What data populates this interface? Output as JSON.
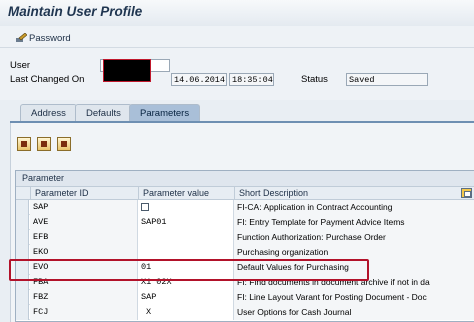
{
  "window": {
    "title": "Maintain User Profile"
  },
  "toolbar": {
    "password_label": "Password"
  },
  "header": {
    "user_label": "User",
    "user_value": "",
    "last_changed_label": "Last Changed On",
    "date_value": "14.06.2014",
    "time_value": "18:35:04",
    "status_label": "Status",
    "status_value": "Saved"
  },
  "tabs": [
    {
      "label": "Address",
      "active": false
    },
    {
      "label": "Defaults",
      "active": false
    },
    {
      "label": "Parameters",
      "active": true
    }
  ],
  "grid": {
    "caption": "Parameter",
    "columns": [
      "Parameter ID",
      "Parameter value",
      "Short Description"
    ],
    "rows": [
      {
        "id": "SAP",
        "value": "",
        "desc": "FI-CA: Application in Contract Accounting"
      },
      {
        "id": "AVE",
        "value": "SAP01",
        "desc": "FI: Entry Template for Payment Advice Items"
      },
      {
        "id": "EFB",
        "value": "",
        "desc": "Function Authorization: Purchase Order"
      },
      {
        "id": "EKO",
        "value": "",
        "desc": "Purchasing organization"
      },
      {
        "id": "EVO",
        "value": "01",
        "desc": "Default Values for Purchasing"
      },
      {
        "id": "FBA",
        "value": "X1 02X",
        "desc": "FI: Find documents in document archive if not in da"
      },
      {
        "id": "FBZ",
        "value": "SAP",
        "desc": "FI: Line Layout Varant for Posting Document - Doc"
      },
      {
        "id": "FCJ",
        "value": "X",
        "desc": "User Options for Cash Journal"
      }
    ]
  },
  "colors": {
    "highlight": "#b2122a",
    "active_tab": "#a9bfd8",
    "title_text": "#1f3550"
  }
}
